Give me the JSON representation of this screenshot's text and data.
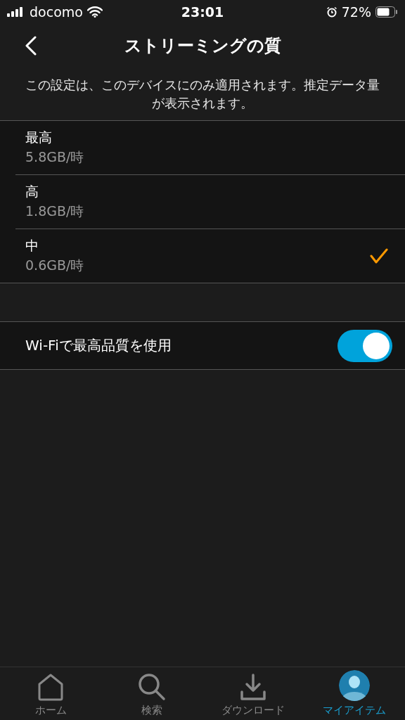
{
  "status_bar": {
    "carrier": "docomo",
    "time": "23:01",
    "battery": "72%"
  },
  "nav": {
    "title": "ストリーミングの質"
  },
  "description": "この設定は、このデバイスにのみ適用されます。推定データ量が表示されます。",
  "options": [
    {
      "label": "最高",
      "rate": "5.8GB/時",
      "selected": false
    },
    {
      "label": "高",
      "rate": "1.8GB/時",
      "selected": false
    },
    {
      "label": "中",
      "rate": "0.6GB/時",
      "selected": true
    }
  ],
  "wifi_setting": {
    "label": "Wi-Fiで最高品質を使用",
    "on": true
  },
  "tabs": [
    {
      "kind": "home",
      "label": "ホーム",
      "selected": false
    },
    {
      "kind": "search",
      "label": "検索",
      "selected": false
    },
    {
      "kind": "download",
      "label": "ダウンロード",
      "selected": false
    },
    {
      "kind": "profile",
      "label": "マイアイテム",
      "selected": true
    }
  ]
}
